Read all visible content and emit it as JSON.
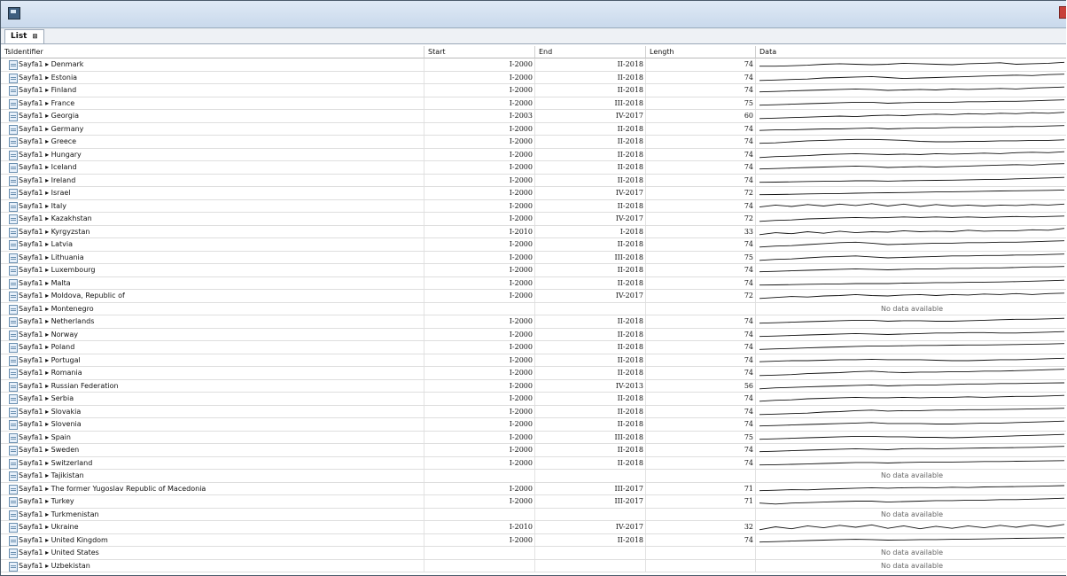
{
  "tab": {
    "label": "List",
    "close_glyph": "⊠"
  },
  "columns": {
    "id": "TsIdentifier",
    "start": "Start",
    "end": "End",
    "length": "Length",
    "data": "Data"
  },
  "no_data_text": "No data available",
  "rows": [
    {
      "id": "Sayfa1 ▸ Denmark",
      "start": "I-2000",
      "end": "II-2018",
      "length": "74",
      "spark": [
        0.3,
        0.3,
        0.35,
        0.4,
        0.5,
        0.55,
        0.5,
        0.45,
        0.5,
        0.6,
        0.55,
        0.5,
        0.45,
        0.55,
        0.6,
        0.65,
        0.5,
        0.55,
        0.6,
        0.7
      ]
    },
    {
      "id": "Sayfa1 ▸ Estonia",
      "start": "I-2000",
      "end": "II-2018",
      "length": "74",
      "spark": [
        0.2,
        0.25,
        0.3,
        0.35,
        0.45,
        0.5,
        0.55,
        0.6,
        0.5,
        0.4,
        0.45,
        0.5,
        0.55,
        0.6,
        0.65,
        0.7,
        0.75,
        0.7,
        0.8,
        0.85
      ]
    },
    {
      "id": "Sayfa1 ▸ Finland",
      "start": "I-2000",
      "end": "II-2018",
      "length": "74",
      "spark": [
        0.3,
        0.35,
        0.4,
        0.45,
        0.5,
        0.55,
        0.6,
        0.55,
        0.45,
        0.5,
        0.55,
        0.5,
        0.6,
        0.55,
        0.6,
        0.65,
        0.6,
        0.7,
        0.75,
        0.8
      ]
    },
    {
      "id": "Sayfa1 ▸ France",
      "start": "I-2000",
      "end": "III-2018",
      "length": "75",
      "spark": [
        0.3,
        0.35,
        0.4,
        0.45,
        0.5,
        0.55,
        0.6,
        0.6,
        0.5,
        0.55,
        0.6,
        0.6,
        0.6,
        0.65,
        0.65,
        0.7,
        0.7,
        0.75,
        0.8,
        0.85
      ]
    },
    {
      "id": "Sayfa1 ▸ Georgia",
      "start": "I-2003",
      "end": "IV-2017",
      "length": "60",
      "spark": [
        0.2,
        0.25,
        0.3,
        0.35,
        0.4,
        0.45,
        0.4,
        0.5,
        0.55,
        0.5,
        0.6,
        0.65,
        0.6,
        0.7,
        0.65,
        0.75,
        0.7,
        0.8,
        0.75,
        0.85
      ]
    },
    {
      "id": "Sayfa1 ▸ Germany",
      "start": "I-2000",
      "end": "II-2018",
      "length": "74",
      "spark": [
        0.35,
        0.4,
        0.4,
        0.45,
        0.5,
        0.5,
        0.55,
        0.6,
        0.5,
        0.55,
        0.6,
        0.6,
        0.65,
        0.65,
        0.7,
        0.7,
        0.75,
        0.75,
        0.8,
        0.85
      ]
    },
    {
      "id": "Sayfa1 ▸ Greece",
      "start": "I-2000",
      "end": "II-2018",
      "length": "74",
      "spark": [
        0.3,
        0.35,
        0.45,
        0.55,
        0.6,
        0.65,
        0.7,
        0.7,
        0.65,
        0.6,
        0.5,
        0.45,
        0.45,
        0.5,
        0.5,
        0.55,
        0.55,
        0.6,
        0.6,
        0.65
      ]
    },
    {
      "id": "Sayfa1 ▸ Hungary",
      "start": "I-2000",
      "end": "II-2018",
      "length": "74",
      "spark": [
        0.2,
        0.3,
        0.35,
        0.4,
        0.5,
        0.55,
        0.6,
        0.55,
        0.5,
        0.55,
        0.5,
        0.6,
        0.55,
        0.6,
        0.65,
        0.6,
        0.7,
        0.75,
        0.7,
        0.8
      ]
    },
    {
      "id": "Sayfa1 ▸ Iceland",
      "start": "I-2000",
      "end": "II-2018",
      "length": "74",
      "spark": [
        0.3,
        0.35,
        0.4,
        0.45,
        0.5,
        0.55,
        0.6,
        0.55,
        0.45,
        0.5,
        0.55,
        0.5,
        0.55,
        0.6,
        0.65,
        0.7,
        0.75,
        0.7,
        0.8,
        0.85
      ]
    },
    {
      "id": "Sayfa1 ▸ Ireland",
      "start": "I-2000",
      "end": "II-2018",
      "length": "74",
      "spark": [
        0.3,
        0.32,
        0.35,
        0.38,
        0.4,
        0.42,
        0.45,
        0.45,
        0.42,
        0.45,
        0.48,
        0.5,
        0.52,
        0.55,
        0.58,
        0.6,
        0.65,
        0.7,
        0.75,
        0.8
      ]
    },
    {
      "id": "Sayfa1 ▸ Israel",
      "start": "I-2000",
      "end": "IV-2017",
      "length": "72",
      "spark": [
        0.3,
        0.32,
        0.35,
        0.38,
        0.4,
        0.42,
        0.45,
        0.48,
        0.5,
        0.52,
        0.55,
        0.58,
        0.6,
        0.62,
        0.65,
        0.68,
        0.7,
        0.72,
        0.75,
        0.78
      ]
    },
    {
      "id": "Sayfa1 ▸ Italy",
      "start": "I-2000",
      "end": "II-2018",
      "length": "74",
      "spark": [
        0.4,
        0.6,
        0.45,
        0.65,
        0.5,
        0.7,
        0.55,
        0.75,
        0.5,
        0.7,
        0.45,
        0.65,
        0.5,
        0.6,
        0.5,
        0.6,
        0.55,
        0.65,
        0.6,
        0.7
      ]
    },
    {
      "id": "Sayfa1 ▸ Kazakhstan",
      "start": "I-2000",
      "end": "IV-2017",
      "length": "72",
      "spark": [
        0.2,
        0.3,
        0.35,
        0.45,
        0.5,
        0.55,
        0.6,
        0.55,
        0.6,
        0.65,
        0.6,
        0.65,
        0.6,
        0.65,
        0.6,
        0.65,
        0.7,
        0.65,
        0.7,
        0.75
      ]
    },
    {
      "id": "Sayfa1 ▸ Kyrgyzstan",
      "start": "I-2010",
      "end": "I-2018",
      "length": "33",
      "spark": [
        0.2,
        0.4,
        0.3,
        0.5,
        0.35,
        0.55,
        0.4,
        0.5,
        0.45,
        0.6,
        0.5,
        0.55,
        0.5,
        0.65,
        0.55,
        0.6,
        0.6,
        0.7,
        0.65,
        0.85
      ]
    },
    {
      "id": "Sayfa1 ▸ Latvia",
      "start": "I-2000",
      "end": "II-2018",
      "length": "74",
      "spark": [
        0.2,
        0.3,
        0.35,
        0.45,
        0.55,
        0.65,
        0.7,
        0.6,
        0.45,
        0.5,
        0.55,
        0.6,
        0.6,
        0.65,
        0.65,
        0.7,
        0.7,
        0.75,
        0.8,
        0.85
      ]
    },
    {
      "id": "Sayfa1 ▸ Lithuania",
      "start": "I-2000",
      "end": "III-2018",
      "length": "75",
      "spark": [
        0.2,
        0.3,
        0.35,
        0.45,
        0.55,
        0.6,
        0.65,
        0.55,
        0.45,
        0.5,
        0.55,
        0.6,
        0.65,
        0.65,
        0.7,
        0.7,
        0.75,
        0.75,
        0.8,
        0.85
      ]
    },
    {
      "id": "Sayfa1 ▸ Luxembourg",
      "start": "I-2000",
      "end": "II-2018",
      "length": "74",
      "spark": [
        0.3,
        0.35,
        0.4,
        0.45,
        0.5,
        0.55,
        0.6,
        0.55,
        0.5,
        0.55,
        0.6,
        0.6,
        0.65,
        0.65,
        0.7,
        0.7,
        0.75,
        0.8,
        0.8,
        0.85
      ]
    },
    {
      "id": "Sayfa1 ▸ Malta",
      "start": "I-2000",
      "end": "II-2018",
      "length": "74",
      "spark": [
        0.3,
        0.32,
        0.35,
        0.38,
        0.4,
        0.42,
        0.45,
        0.45,
        0.45,
        0.5,
        0.52,
        0.55,
        0.55,
        0.58,
        0.6,
        0.62,
        0.65,
        0.7,
        0.75,
        0.8
      ]
    },
    {
      "id": "Sayfa1 ▸ Moldova, Republic of",
      "start": "I-2000",
      "end": "IV-2017",
      "length": "72",
      "spark": [
        0.2,
        0.3,
        0.4,
        0.35,
        0.45,
        0.5,
        0.6,
        0.5,
        0.45,
        0.55,
        0.6,
        0.5,
        0.6,
        0.55,
        0.65,
        0.6,
        0.7,
        0.6,
        0.7,
        0.75
      ]
    },
    {
      "id": "Sayfa1 ▸ Montenegro",
      "start": "",
      "end": "",
      "length": "",
      "spark": []
    },
    {
      "id": "Sayfa1 ▸ Netherlands",
      "start": "I-2000",
      "end": "II-2018",
      "length": "74",
      "spark": [
        0.3,
        0.35,
        0.4,
        0.45,
        0.5,
        0.55,
        0.6,
        0.6,
        0.5,
        0.55,
        0.55,
        0.5,
        0.5,
        0.55,
        0.6,
        0.65,
        0.7,
        0.7,
        0.75,
        0.8
      ]
    },
    {
      "id": "Sayfa1 ▸ Norway",
      "start": "I-2000",
      "end": "II-2018",
      "length": "74",
      "spark": [
        0.3,
        0.35,
        0.4,
        0.45,
        0.5,
        0.55,
        0.6,
        0.55,
        0.5,
        0.55,
        0.6,
        0.65,
        0.65,
        0.7,
        0.7,
        0.65,
        0.65,
        0.7,
        0.75,
        0.8
      ]
    },
    {
      "id": "Sayfa1 ▸ Poland",
      "start": "I-2000",
      "end": "II-2018",
      "length": "74",
      "spark": [
        0.25,
        0.3,
        0.35,
        0.4,
        0.45,
        0.5,
        0.55,
        0.6,
        0.6,
        0.62,
        0.65,
        0.65,
        0.68,
        0.7,
        0.7,
        0.72,
        0.75,
        0.78,
        0.8,
        0.85
      ]
    },
    {
      "id": "Sayfa1 ▸ Portugal",
      "start": "I-2000",
      "end": "II-2018",
      "length": "74",
      "spark": [
        0.35,
        0.4,
        0.45,
        0.45,
        0.5,
        0.55,
        0.55,
        0.6,
        0.55,
        0.55,
        0.55,
        0.5,
        0.45,
        0.45,
        0.5,
        0.55,
        0.55,
        0.6,
        0.65,
        0.7
      ]
    },
    {
      "id": "Sayfa1 ▸ Romania",
      "start": "I-2000",
      "end": "II-2018",
      "length": "74",
      "spark": [
        0.2,
        0.25,
        0.3,
        0.4,
        0.45,
        0.5,
        0.6,
        0.65,
        0.55,
        0.5,
        0.55,
        0.55,
        0.6,
        0.6,
        0.65,
        0.65,
        0.7,
        0.75,
        0.8,
        0.85
      ]
    },
    {
      "id": "Sayfa1 ▸ Russian Federation",
      "start": "I-2000",
      "end": "IV-2013",
      "length": "56",
      "spark": [
        0.2,
        0.3,
        0.35,
        0.4,
        0.45,
        0.5,
        0.55,
        0.6,
        0.5,
        0.55,
        0.6,
        0.6,
        0.65,
        0.7,
        0.7,
        0.75,
        0.75,
        0.78,
        0.8,
        0.82
      ]
    },
    {
      "id": "Sayfa1 ▸ Serbia",
      "start": "I-2000",
      "end": "II-2018",
      "length": "74",
      "spark": [
        0.2,
        0.3,
        0.35,
        0.45,
        0.5,
        0.55,
        0.6,
        0.55,
        0.55,
        0.6,
        0.55,
        0.6,
        0.6,
        0.65,
        0.6,
        0.65,
        0.7,
        0.7,
        0.75,
        0.8
      ]
    },
    {
      "id": "Sayfa1 ▸ Slovakia",
      "start": "I-2000",
      "end": "II-2018",
      "length": "74",
      "spark": [
        0.2,
        0.25,
        0.3,
        0.35,
        0.45,
        0.5,
        0.6,
        0.65,
        0.55,
        0.6,
        0.6,
        0.65,
        0.65,
        0.7,
        0.7,
        0.72,
        0.75,
        0.78,
        0.8,
        0.85
      ]
    },
    {
      "id": "Sayfa1 ▸ Slovenia",
      "start": "I-2000",
      "end": "II-2018",
      "length": "74",
      "spark": [
        0.3,
        0.35,
        0.4,
        0.45,
        0.5,
        0.55,
        0.6,
        0.65,
        0.55,
        0.55,
        0.55,
        0.5,
        0.5,
        0.55,
        0.6,
        0.6,
        0.65,
        0.7,
        0.75,
        0.8
      ]
    },
    {
      "id": "Sayfa1 ▸ Spain",
      "start": "I-2000",
      "end": "III-2018",
      "length": "75",
      "spark": [
        0.3,
        0.35,
        0.4,
        0.45,
        0.5,
        0.55,
        0.6,
        0.6,
        0.55,
        0.55,
        0.5,
        0.5,
        0.45,
        0.5,
        0.55,
        0.6,
        0.65,
        0.7,
        0.75,
        0.8
      ]
    },
    {
      "id": "Sayfa1 ▸ Sweden",
      "start": "I-2000",
      "end": "II-2018",
      "length": "74",
      "spark": [
        0.3,
        0.35,
        0.4,
        0.45,
        0.5,
        0.55,
        0.6,
        0.55,
        0.5,
        0.6,
        0.62,
        0.6,
        0.62,
        0.65,
        0.68,
        0.7,
        0.72,
        0.75,
        0.8,
        0.85
      ]
    },
    {
      "id": "Sayfa1 ▸ Switzerland",
      "start": "I-2000",
      "end": "II-2018",
      "length": "74",
      "spark": [
        0.3,
        0.33,
        0.36,
        0.4,
        0.45,
        0.5,
        0.55,
        0.55,
        0.5,
        0.55,
        0.58,
        0.6,
        0.6,
        0.62,
        0.65,
        0.65,
        0.68,
        0.7,
        0.72,
        0.75
      ]
    },
    {
      "id": "Sayfa1 ▸ Tajikistan",
      "start": "",
      "end": "",
      "length": "",
      "spark": []
    },
    {
      "id": "Sayfa1 ▸ The former Yugoslav Republic of Macedonia",
      "start": "I-2000",
      "end": "III-2017",
      "length": "71",
      "spark": [
        0.3,
        0.35,
        0.4,
        0.38,
        0.45,
        0.5,
        0.55,
        0.6,
        0.55,
        0.6,
        0.62,
        0.6,
        0.65,
        0.62,
        0.68,
        0.7,
        0.72,
        0.75,
        0.78,
        0.82
      ]
    },
    {
      "id": "Sayfa1 ▸ Turkey",
      "start": "I-2000",
      "end": "III-2017",
      "length": "71",
      "spark": [
        0.3,
        0.2,
        0.3,
        0.35,
        0.4,
        0.45,
        0.5,
        0.5,
        0.4,
        0.45,
        0.5,
        0.55,
        0.55,
        0.6,
        0.6,
        0.65,
        0.65,
        0.7,
        0.75,
        0.8
      ]
    },
    {
      "id": "Sayfa1 ▸ Turkmenistan",
      "start": "",
      "end": "",
      "length": "",
      "spark": []
    },
    {
      "id": "Sayfa1 ▸ Ukraine",
      "start": "I-2010",
      "end": "IV-2017",
      "length": "32",
      "spark": [
        0.2,
        0.5,
        0.3,
        0.6,
        0.4,
        0.65,
        0.45,
        0.7,
        0.35,
        0.6,
        0.3,
        0.55,
        0.35,
        0.6,
        0.4,
        0.65,
        0.45,
        0.7,
        0.5,
        0.75
      ]
    },
    {
      "id": "Sayfa1 ▸ United Kingdom",
      "start": "I-2000",
      "end": "II-2018",
      "length": "74",
      "spark": [
        0.3,
        0.35,
        0.4,
        0.45,
        0.5,
        0.55,
        0.58,
        0.55,
        0.5,
        0.52,
        0.55,
        0.55,
        0.58,
        0.6,
        0.62,
        0.65,
        0.68,
        0.7,
        0.72,
        0.75
      ]
    },
    {
      "id": "Sayfa1 ▸ United States",
      "start": "",
      "end": "",
      "length": "",
      "spark": []
    },
    {
      "id": "Sayfa1 ▸ Uzbekistan",
      "start": "",
      "end": "",
      "length": "",
      "spark": []
    }
  ]
}
